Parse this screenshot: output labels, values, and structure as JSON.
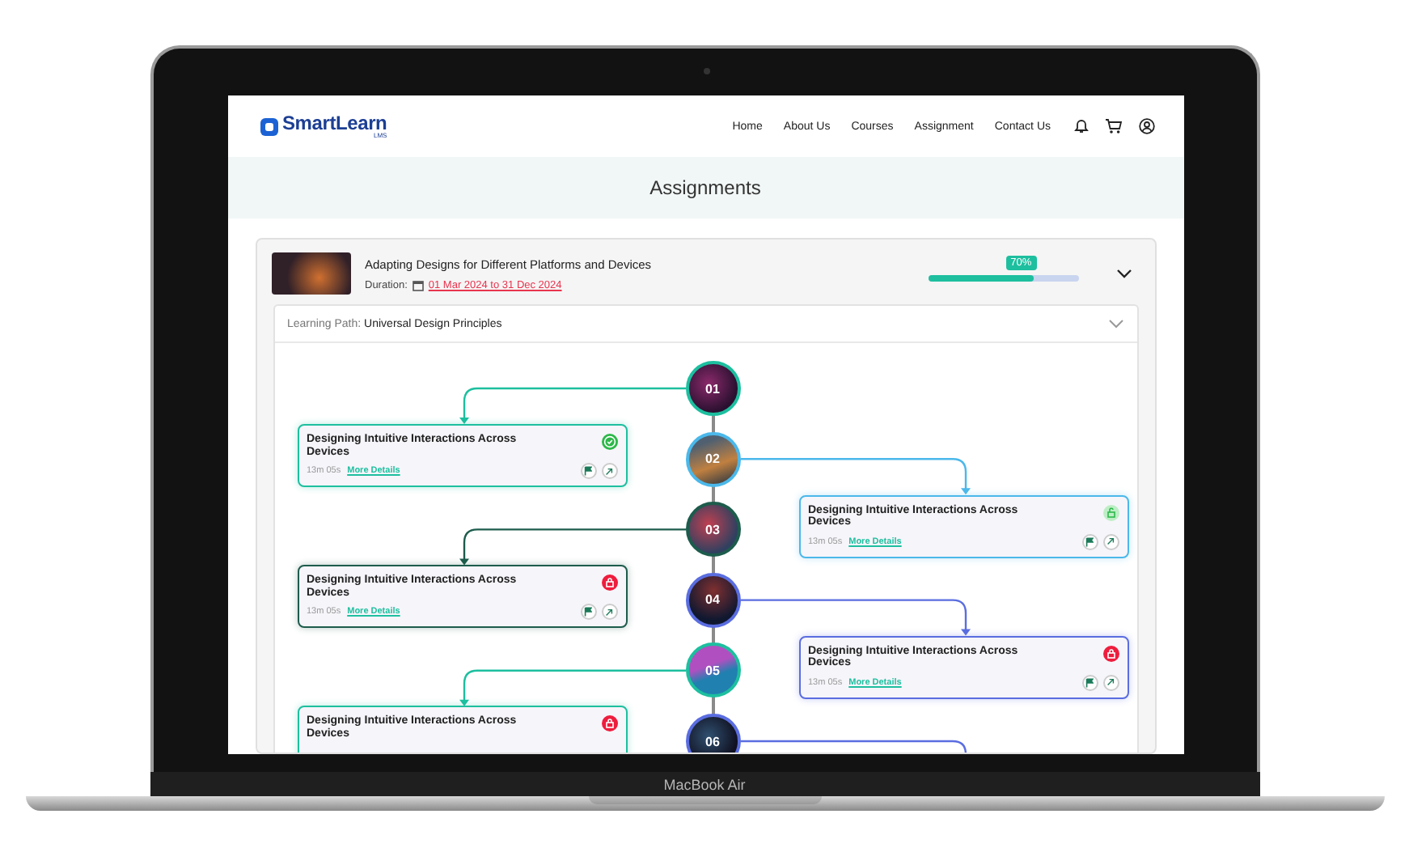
{
  "device": {
    "label": "MacBook Air"
  },
  "nav": {
    "logo": "SmartLearn",
    "logo_sub": "LMS",
    "links": [
      {
        "label": "Home"
      },
      {
        "label": "About Us"
      },
      {
        "label": "Courses"
      },
      {
        "label": "Assignment"
      },
      {
        "label": "Contact Us"
      }
    ]
  },
  "page_title": "Assignments",
  "course": {
    "title": "Adapting Designs for Different Platforms and Devices",
    "duration_label": "Duration:",
    "dates": "01 Mar 2024 to 31 Dec 2024",
    "progress_label": "70%",
    "level": 0.7
  },
  "learning_path": {
    "label": "Learning Path:",
    "name": "Universal Design Principles"
  },
  "steps": [
    {
      "number": "01",
      "color": "#1dbf9f",
      "kind": "completed",
      "title": "Designing Intuitive Interactions Across Devices",
      "duration": "13m 05s",
      "link": "More Details"
    },
    {
      "number": "02",
      "color": "#4bb8ea",
      "kind": "unlocked",
      "title": "Designing Intuitive Interactions Across Devices",
      "duration": "13m 05s",
      "link": "More Details"
    },
    {
      "number": "03",
      "color": "#1d5c4c",
      "kind": "locked",
      "title": "Designing Intuitive Interactions Across Devices",
      "duration": "13m 05s",
      "link": "More Details"
    },
    {
      "number": "04",
      "color": "#5a6de0",
      "kind": "locked",
      "title": "Designing Intuitive Interactions Across Devices",
      "duration": "13m 05s",
      "link": "More Details"
    },
    {
      "number": "05",
      "color": "#1dbf9f",
      "kind": "locked",
      "title": "Designing Intuitive Interactions Across Devices"
    },
    {
      "number": "06",
      "color": "#5a6de0"
    }
  ]
}
